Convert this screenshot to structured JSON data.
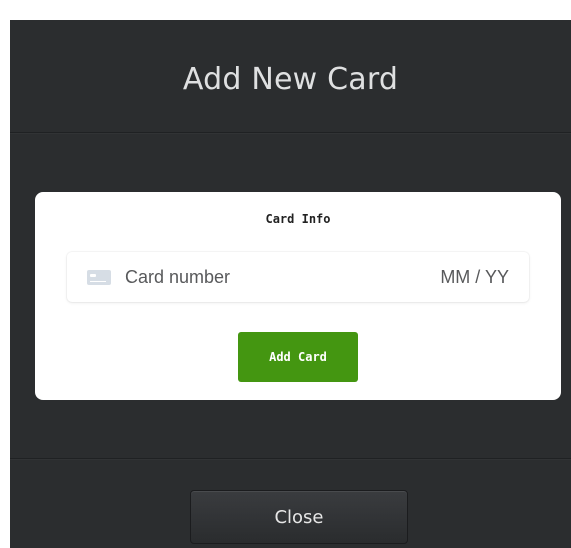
{
  "modal": {
    "title": "Add New Card",
    "card_form": {
      "title": "Card Info",
      "card_number_placeholder": "Card number",
      "expiry_placeholder": "MM / YY",
      "submit_label": "Add Card",
      "icon": "credit-card-icon"
    },
    "close_label": "Close"
  },
  "colors": {
    "modal_background": "#2b2d2f",
    "panel_background": "#ffffff",
    "submit_button": "#449611",
    "title_text": "#dfe0e1"
  }
}
